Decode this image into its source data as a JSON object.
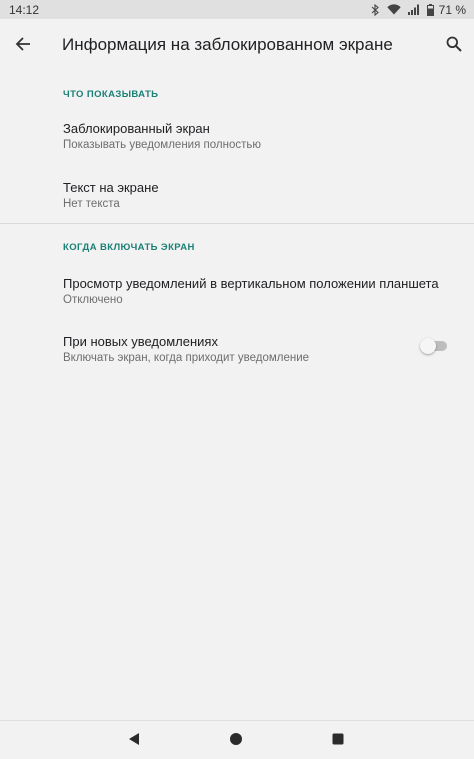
{
  "status_bar": {
    "time": "14:12",
    "battery_percent": "71 %",
    "icons": [
      "bluetooth-icon",
      "wifi-icon",
      "signal-icon",
      "battery-icon"
    ]
  },
  "app_bar": {
    "title": "Информация на заблокированном экране",
    "back_icon": "arrow-back-icon",
    "search_icon": "search-icon"
  },
  "sections": [
    {
      "header": "ЧТО ПОКАЗЫВАТЬ",
      "items": [
        {
          "title": "Заблокированный экран",
          "summary": "Показывать уведомления полностью"
        },
        {
          "title": "Текст на экране",
          "summary": "Нет текста"
        }
      ]
    },
    {
      "header": "КОГДА ВКЛЮЧАТЬ ЭКРАН",
      "items": [
        {
          "title": "Просмотр уведомлений в вертикальном положении планшета",
          "summary": "Отключено"
        },
        {
          "title": "При новых уведомлениях",
          "summary": "Включать экран, когда приходит уведомление",
          "switch_on": false
        }
      ]
    }
  ],
  "colors": {
    "accent": "#1a8075",
    "background": "#f2f2f2",
    "status_bar": "#e0e0e0"
  },
  "nav_bar": {
    "icons": [
      "back-triangle-icon",
      "home-circle-icon",
      "recents-square-icon"
    ]
  }
}
